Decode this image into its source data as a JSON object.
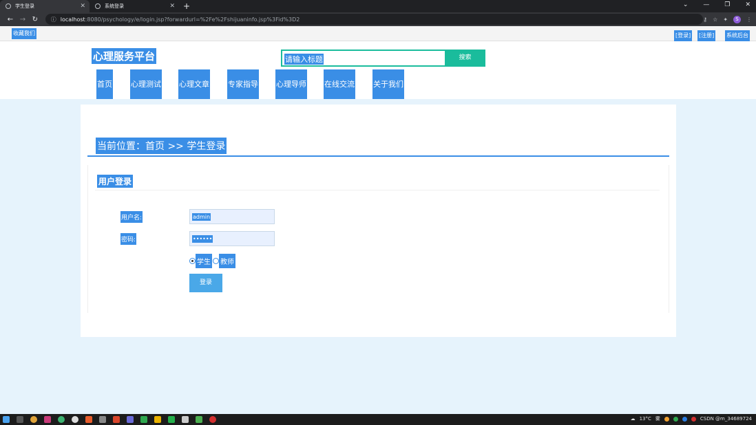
{
  "browser": {
    "tabs": [
      {
        "title": "学生登录",
        "active": true
      },
      {
        "title": "系统登录",
        "active": false
      }
    ],
    "new_tab": "+",
    "url_host": "localhost",
    "url_path": ":8080/psychology/e/login.jsp?forwardurl=%2Fe%2Fshijuaninfo.jsp%3Fid%3D2",
    "profile_initial": "S"
  },
  "topbar": {
    "favorite": "收藏我们",
    "login": "[登录]",
    "register": "[注册]",
    "admin": "系统后台"
  },
  "header": {
    "logo": "心理服务平台",
    "search_placeholder": "请输入标题",
    "search_button": "搜索"
  },
  "nav": {
    "items": [
      {
        "label": "首页"
      },
      {
        "label": "心理测试"
      },
      {
        "label": "心理文章"
      },
      {
        "label": "专家指导"
      },
      {
        "label": "心理导师"
      },
      {
        "label": "在线交流"
      },
      {
        "label": "关于我们"
      }
    ]
  },
  "breadcrumb": "当前位置：首页 >> 学生登录",
  "login_panel": {
    "title": "用户登录",
    "username_label": "用户名:",
    "username_value": "admin",
    "password_label": "密码:",
    "password_value": "••••••",
    "roles": [
      {
        "label": "学生",
        "checked": true
      },
      {
        "label": "教师",
        "checked": false
      }
    ],
    "submit": "登录"
  },
  "taskbar": {
    "temperature": "13°C",
    "weather": "雾",
    "tray_text": "CSDN @m_34689724"
  },
  "colors": {
    "accent_blue": "#3a8ee6",
    "search_green": "#1abc9c",
    "page_bg": "#e6f3fc"
  }
}
